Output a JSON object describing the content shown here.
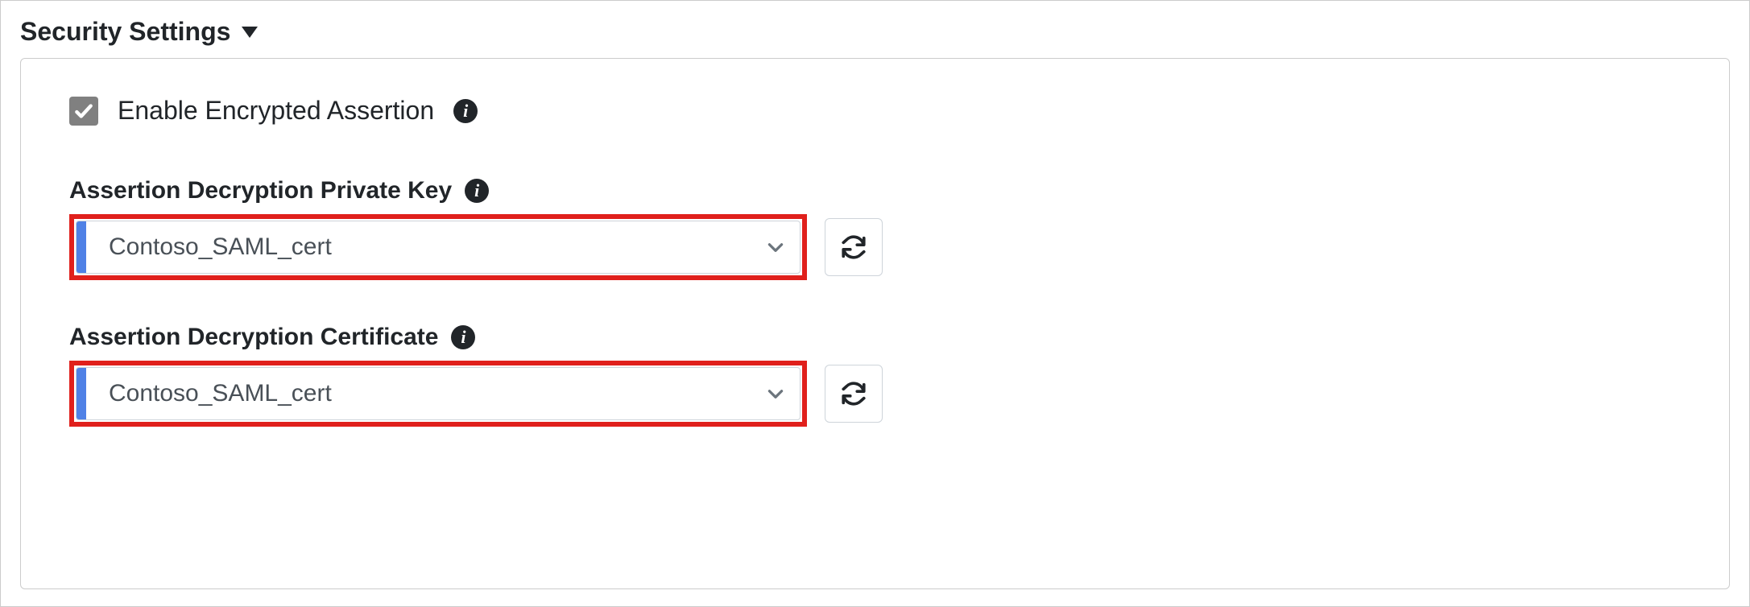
{
  "section": {
    "title": "Security Settings"
  },
  "enable_encrypted": {
    "label": "Enable Encrypted Assertion",
    "checked": true
  },
  "fields": {
    "private_key": {
      "label": "Assertion Decryption Private Key",
      "value": "Contoso_SAML_cert"
    },
    "certificate": {
      "label": "Assertion Decryption Certificate",
      "value": "Contoso_SAML_cert"
    }
  }
}
